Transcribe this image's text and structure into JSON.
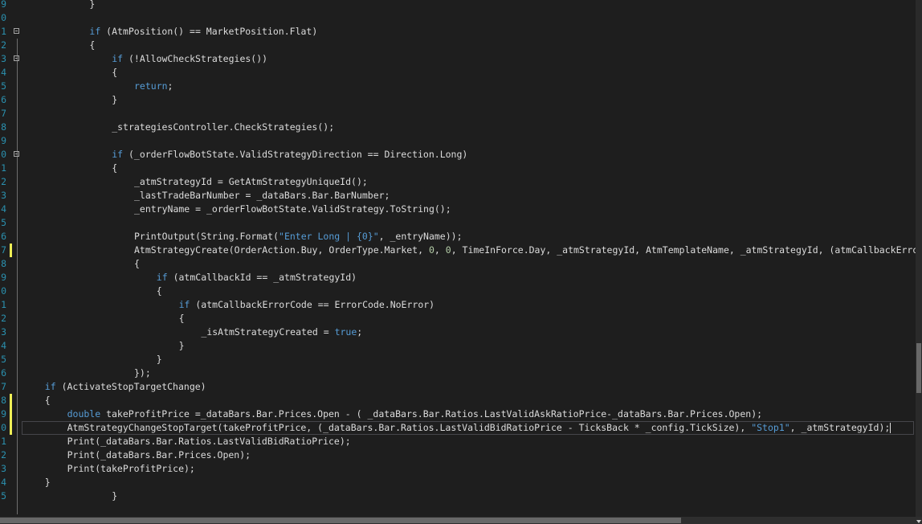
{
  "lines": [
    {
      "ln": "9",
      "indent": 3,
      "fold": false,
      "modified": false,
      "tokens": [
        [
          "p",
          "}"
        ]
      ]
    },
    {
      "ln": "0",
      "indent": 0,
      "fold": false,
      "modified": false,
      "tokens": []
    },
    {
      "ln": "1",
      "indent": 3,
      "fold": true,
      "modified": false,
      "tokens": [
        [
          "kw",
          "if"
        ],
        [
          "p",
          " (AtmPosition() == MarketPosition.Flat)"
        ]
      ]
    },
    {
      "ln": "2",
      "indent": 3,
      "fold": false,
      "modified": false,
      "tokens": [
        [
          "p",
          "{"
        ]
      ]
    },
    {
      "ln": "3",
      "indent": 4,
      "fold": true,
      "modified": false,
      "tokens": [
        [
          "kw",
          "if"
        ],
        [
          "p",
          " (!AllowCheckStrategies())"
        ]
      ]
    },
    {
      "ln": "4",
      "indent": 4,
      "fold": false,
      "modified": false,
      "tokens": [
        [
          "p",
          "{"
        ]
      ]
    },
    {
      "ln": "5",
      "indent": 5,
      "fold": false,
      "modified": false,
      "tokens": [
        [
          "kw",
          "return"
        ],
        [
          "p",
          ";"
        ]
      ]
    },
    {
      "ln": "6",
      "indent": 4,
      "fold": false,
      "modified": false,
      "tokens": [
        [
          "p",
          "}"
        ]
      ]
    },
    {
      "ln": "7",
      "indent": 0,
      "fold": false,
      "modified": false,
      "tokens": []
    },
    {
      "ln": "8",
      "indent": 4,
      "fold": false,
      "modified": false,
      "tokens": [
        [
          "p",
          "_strategiesController.CheckStrategies();"
        ]
      ]
    },
    {
      "ln": "9",
      "indent": 0,
      "fold": false,
      "modified": false,
      "tokens": []
    },
    {
      "ln": "0",
      "indent": 4,
      "fold": true,
      "modified": false,
      "tokens": [
        [
          "kw",
          "if"
        ],
        [
          "p",
          " (_orderFlowBotState.ValidStrategyDirection == Direction.Long)"
        ]
      ]
    },
    {
      "ln": "1",
      "indent": 4,
      "fold": false,
      "modified": false,
      "tokens": [
        [
          "p",
          "{"
        ]
      ]
    },
    {
      "ln": "2",
      "indent": 5,
      "fold": false,
      "modified": false,
      "tokens": [
        [
          "p",
          "_atmStrategyId = GetAtmStrategyUniqueId();"
        ]
      ]
    },
    {
      "ln": "3",
      "indent": 5,
      "fold": false,
      "modified": false,
      "tokens": [
        [
          "p",
          "_lastTradeBarNumber = _dataBars.Bar.BarNumber;"
        ]
      ]
    },
    {
      "ln": "4",
      "indent": 5,
      "fold": false,
      "modified": false,
      "tokens": [
        [
          "p",
          "_entryName = _orderFlowBotState.ValidStrategy.ToString();"
        ]
      ]
    },
    {
      "ln": "5",
      "indent": 0,
      "fold": false,
      "modified": false,
      "tokens": []
    },
    {
      "ln": "6",
      "indent": 5,
      "fold": false,
      "modified": false,
      "tokens": [
        [
          "p",
          "PrintOutput(String.Format("
        ],
        [
          "strb",
          "\"Enter Long | {0}\""
        ],
        [
          "p",
          ", _entryName));"
        ]
      ]
    },
    {
      "ln": "7",
      "indent": 5,
      "fold": false,
      "modified": true,
      "tokens": [
        [
          "p",
          "AtmStrategyCreate(OrderAction.Buy, OrderType.Market, "
        ],
        [
          "num",
          "0"
        ],
        [
          "p",
          ", "
        ],
        [
          "num",
          "0"
        ],
        [
          "p",
          ", TimeInForce.Day, _atmStrategyId, AtmTemplateName, _atmStrategyId, (atmCallbackErrorCode, atmCallbackId) =>"
        ]
      ]
    },
    {
      "ln": "8",
      "indent": 5,
      "fold": false,
      "modified": false,
      "tokens": [
        [
          "p",
          "{"
        ]
      ]
    },
    {
      "ln": "9",
      "indent": 6,
      "fold": false,
      "modified": false,
      "tokens": [
        [
          "kw",
          "if"
        ],
        [
          "p",
          " (atmCallbackId == _atmStrategyId)"
        ]
      ]
    },
    {
      "ln": "0",
      "indent": 6,
      "fold": false,
      "modified": false,
      "tokens": [
        [
          "p",
          "{"
        ]
      ]
    },
    {
      "ln": "1",
      "indent": 7,
      "fold": false,
      "modified": false,
      "tokens": [
        [
          "kw",
          "if"
        ],
        [
          "p",
          " (atmCallbackErrorCode == ErrorCode.NoError)"
        ]
      ]
    },
    {
      "ln": "2",
      "indent": 7,
      "fold": false,
      "modified": false,
      "tokens": [
        [
          "p",
          "{"
        ]
      ]
    },
    {
      "ln": "3",
      "indent": 8,
      "fold": false,
      "modified": false,
      "tokens": [
        [
          "p",
          "_isAtmStrategyCreated = "
        ],
        [
          "kw",
          "true"
        ],
        [
          "p",
          ";"
        ]
      ]
    },
    {
      "ln": "4",
      "indent": 7,
      "fold": false,
      "modified": false,
      "tokens": [
        [
          "p",
          "}"
        ]
      ]
    },
    {
      "ln": "5",
      "indent": 6,
      "fold": false,
      "modified": false,
      "tokens": [
        [
          "p",
          "}"
        ]
      ]
    },
    {
      "ln": "6",
      "indent": 5,
      "fold": false,
      "modified": false,
      "tokens": [
        [
          "p",
          "});"
        ]
      ]
    },
    {
      "ln": "7",
      "indent": 1,
      "fold": false,
      "modified": false,
      "tokens": [
        [
          "kw",
          "if"
        ],
        [
          "p",
          " (ActivateStopTargetChange)"
        ]
      ]
    },
    {
      "ln": "8",
      "indent": 1,
      "fold": false,
      "modified": true,
      "tokens": [
        [
          "p",
          "{"
        ]
      ]
    },
    {
      "ln": "9",
      "indent": 2,
      "fold": false,
      "modified": true,
      "tokens": [
        [
          "kw",
          "double"
        ],
        [
          "p",
          " takeProfitPrice =_dataBars.Bar.Prices.Open - ( _dataBars.Bar.Ratios.LastValidAskRatioPrice-_dataBars.Bar.Prices.Open);"
        ]
      ]
    },
    {
      "ln": "0",
      "indent": 2,
      "fold": false,
      "modified": true,
      "current": true,
      "tokens": [
        [
          "p",
          "AtmStrategyChangeStopTarget(takeProfitPrice, (_dataBars.Bar.Ratios.LastValidBidRatioPrice - TicksBack * _config.TickSize), "
        ],
        [
          "strb",
          "\"Stop1\""
        ],
        [
          "p",
          ", _atmStrategyId);"
        ]
      ]
    },
    {
      "ln": "1",
      "indent": 2,
      "fold": false,
      "modified": false,
      "tokens": [
        [
          "p",
          "Print(_dataBars.Bar.Ratios.LastValidBidRatioPrice);"
        ]
      ]
    },
    {
      "ln": "2",
      "indent": 2,
      "fold": false,
      "modified": false,
      "tokens": [
        [
          "p",
          "Print(_dataBars.Bar.Prices.Open);"
        ]
      ]
    },
    {
      "ln": "3",
      "indent": 2,
      "fold": false,
      "modified": false,
      "tokens": [
        [
          "p",
          "Print(takeProfitPrice);"
        ]
      ]
    },
    {
      "ln": "4",
      "indent": 1,
      "fold": false,
      "modified": false,
      "tokens": [
        [
          "p",
          "}"
        ]
      ]
    },
    {
      "ln": "5",
      "indent": 4,
      "fold": false,
      "modified": false,
      "tokens": [
        [
          "p",
          "}"
        ]
      ]
    }
  ],
  "colors": {
    "background": "#1e1e1e",
    "keyword": "#569cd6",
    "string": "#569cd6",
    "number": "#b5cea8",
    "line_number": "#2b91af",
    "modified_marker": "#efef56"
  }
}
